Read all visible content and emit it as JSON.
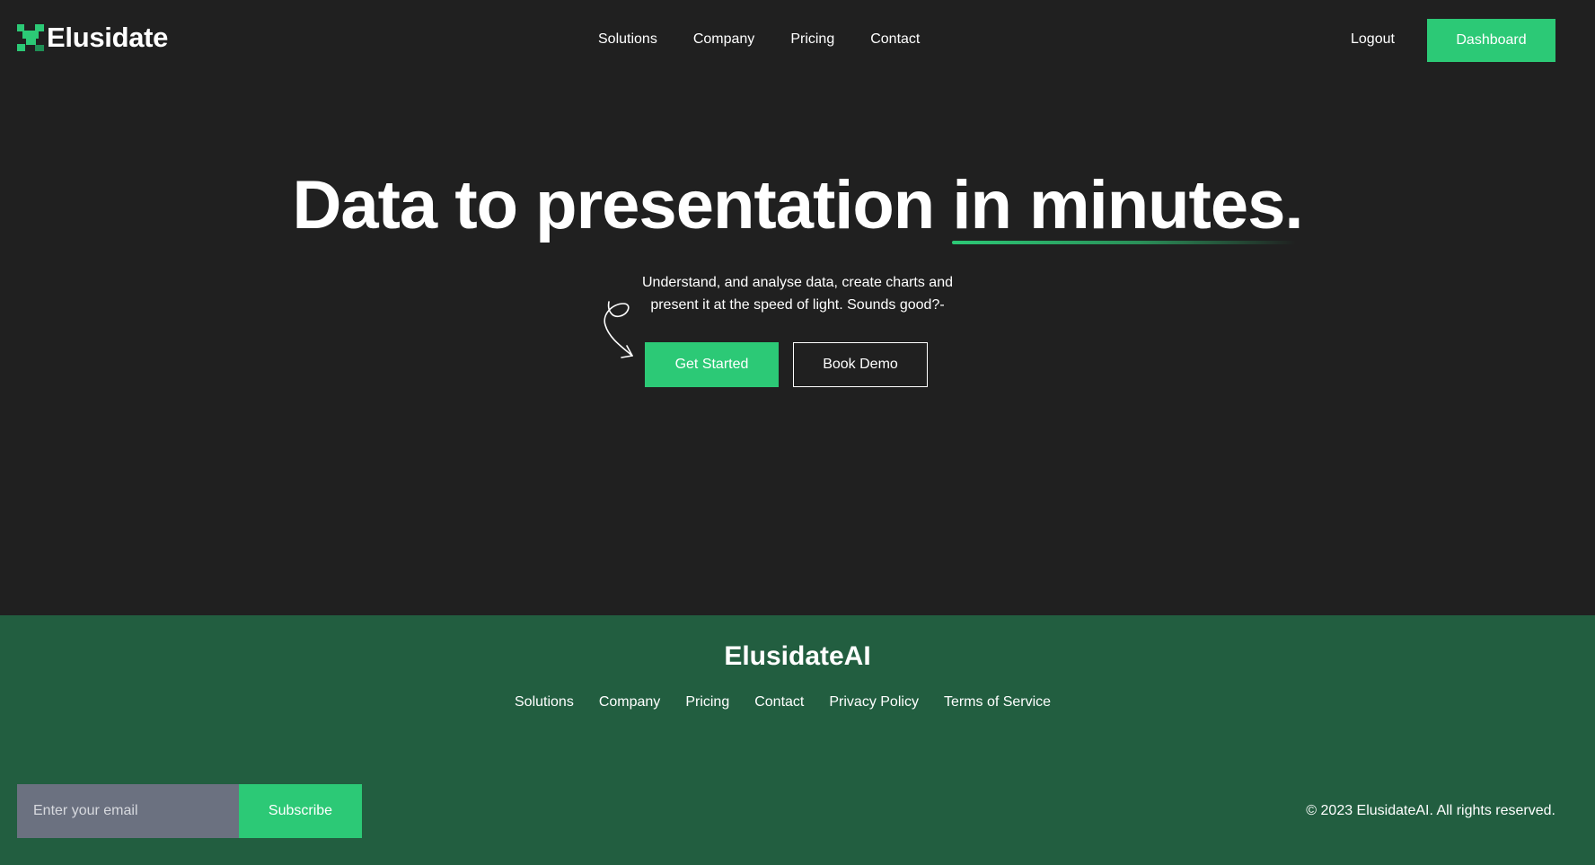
{
  "brand": {
    "name": "Elusidate",
    "logo_icon": "elusidate-logo-icon",
    "accent_color": "#2cc976"
  },
  "header": {
    "nav": [
      "Solutions",
      "Company",
      "Pricing",
      "Contact"
    ],
    "logout_label": "Logout",
    "dashboard_label": "Dashboard"
  },
  "hero": {
    "title_main": "Data to presentation ",
    "title_highlight": "in minutes.",
    "subtitle": "Understand, and analyse data, create charts and present it at the speed of light. Sounds good?-",
    "arrow_icon": "squiggle-arrow-icon",
    "cta_primary": "Get Started",
    "cta_secondary": "Book Demo"
  },
  "footer": {
    "background_color": "#225e40",
    "brand": "ElusidateAI",
    "links": [
      "Solutions",
      "Company",
      "Pricing",
      "Contact",
      "Privacy Policy",
      "Terms of Service"
    ],
    "email_placeholder": "Enter your email",
    "email_value": "",
    "subscribe_label": "Subscribe",
    "copyright": "© 2023 ElusidateAI. All rights reserved."
  }
}
